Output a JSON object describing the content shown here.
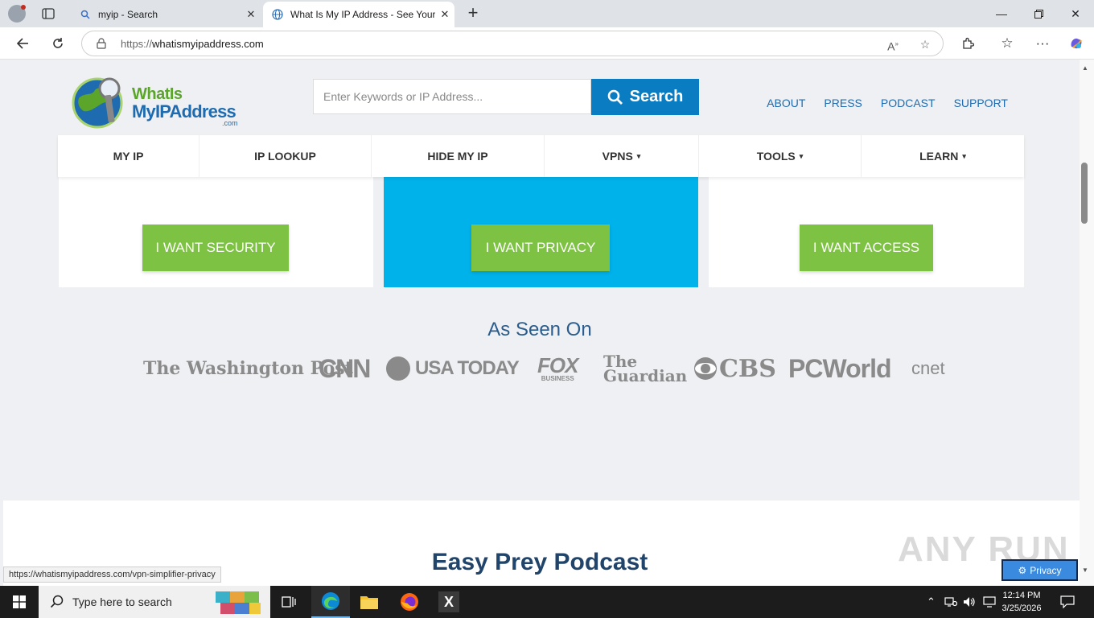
{
  "browser": {
    "tabs": [
      {
        "title": "myip - Search",
        "active": false
      },
      {
        "title": "What Is My IP Address - See Your",
        "active": true
      }
    ],
    "url_protocol": "https://",
    "url_host": "whatismyipaddress.com"
  },
  "site": {
    "logo": {
      "line1": "WhatIs",
      "line2": "MyIPAddress",
      "line3": ".com"
    },
    "search": {
      "placeholder": "Enter Keywords or IP Address...",
      "button_label": "Search"
    },
    "top_links": [
      "ABOUT",
      "PRESS",
      "PODCAST",
      "SUPPORT"
    ],
    "nav": [
      {
        "label": "MY IP",
        "has_caret": false
      },
      {
        "label": "IP LOOKUP",
        "has_caret": false
      },
      {
        "label": "HIDE MY IP",
        "has_caret": false
      },
      {
        "label": "VPNS",
        "has_caret": true
      },
      {
        "label": "TOOLS",
        "has_caret": true
      },
      {
        "label": "LEARN",
        "has_caret": true
      }
    ],
    "caret": "▾",
    "cta": {
      "security": "I WANT SECURITY",
      "privacy": "I WANT PRIVACY",
      "access": "I WANT ACCESS"
    },
    "as_seen_on": "As Seen On",
    "press": [
      "The Washington Post",
      "CNN",
      "USA TODAY",
      "FOX",
      "BUSINESS",
      "The Guardian",
      "CBS",
      "PCWorld",
      "cnet"
    ],
    "podcast_title": "Easy Prey Podcast"
  },
  "status_url": "https://whatismyipaddress.com/vpn-simplifier-privacy",
  "watermark": "ANY RUN",
  "privacy_badge": "Privacy",
  "taskbar": {
    "search_placeholder": "Type here to search",
    "time": "12:14 PM",
    "date": "3/25/2026"
  },
  "colors": {
    "brand_blue": "#0a7cc1",
    "cta_green": "#7dc242",
    "privacy_card": "#00b2ea",
    "nav_link": "#1e6bb0"
  }
}
